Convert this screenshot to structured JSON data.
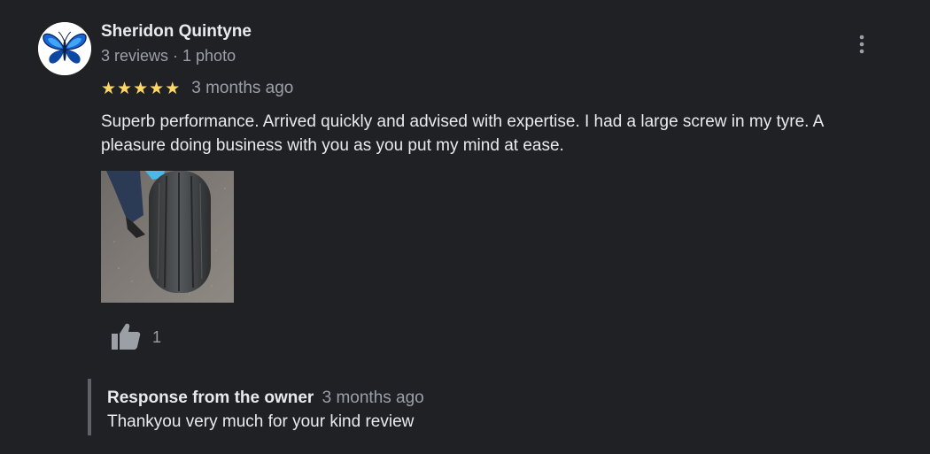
{
  "review": {
    "reviewer": {
      "name": "Sheridon Quintyne",
      "meta": "3 reviews · 1 photo",
      "avatar_icon": "butterfly-icon"
    },
    "rating": {
      "stars": 5,
      "max": 5,
      "date": "3 months ago"
    },
    "text": "Superb performance. Arrived quickly and advised with expertise. I had a large screw in my tyre. A pleasure doing business with you as you put my mind at ease.",
    "photo_icon": "tyre-photo",
    "likes": {
      "icon": "thumbs-up-icon",
      "count": "1"
    },
    "more_icon": "more-vert-icon"
  },
  "owner_response": {
    "label": "Response from the owner",
    "date": "3 months ago",
    "text": "Thankyou very much for your kind review"
  },
  "colors": {
    "background": "#202124",
    "text_primary": "#e8eaed",
    "text_secondary": "#9aa0a6",
    "star": "#fdd663",
    "response_bar": "#5f6368"
  }
}
